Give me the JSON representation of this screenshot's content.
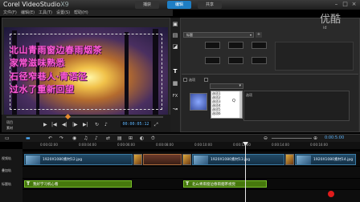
{
  "window": {
    "title_main": "Corel VideoStudio",
    "title_ver": "X9"
  },
  "steps": [
    {
      "label": "捕获",
      "active": false
    },
    {
      "label": "编辑",
      "active": true
    },
    {
      "label": "共享",
      "active": false
    }
  ],
  "menu": [
    "文件(F)",
    "编辑(E)",
    "工具(T)",
    "设置(S)",
    "帮助(H)"
  ],
  "preview": {
    "captions": [
      "北山青雨窗边春雨烟茶",
      "家常滋味熟悉",
      "石径窄巷人·青语径",
      "过水了重新回望"
    ],
    "mode_project": "项目",
    "mode_clip": "素材",
    "timecode": "00:00:05:12"
  },
  "library": {
    "category_dropdown": "标题",
    "listbox_items": [
      "选项1",
      "选项2",
      "选项3",
      "选项4",
      "选项5",
      "选项6"
    ],
    "listbox_label": "Q",
    "options_label": "选项",
    "checkbox_label": "选项"
  },
  "timeline": {
    "ruler_ticks": [
      "0:00:02:00",
      "0:00:04:00",
      "0:00:06:00",
      "0:00:08:00",
      "0:00:10:00",
      "0:00:12:00",
      "0:00:14:00",
      "0:00:16:00"
    ],
    "time_readout": "0:00:5:00",
    "video_clips": [
      "1920X1080素材12.jpg",
      "1920X1080素材13.jpg",
      "1920X1080素材14.jpg"
    ],
    "title_clips": [
      "我好学习机心看",
      "北山青雨窗边春雨烟茶视觉"
    ],
    "track_labels": [
      "视频轨",
      "叠加轨",
      "标题轨"
    ]
  },
  "watermark": {
    "logo": "优酷",
    "id": "id"
  },
  "colors": {
    "accent": "#1e7ec4",
    "caption": "#ff5ad8",
    "title_clip": "#46780d",
    "video_clip": "#224a66"
  }
}
